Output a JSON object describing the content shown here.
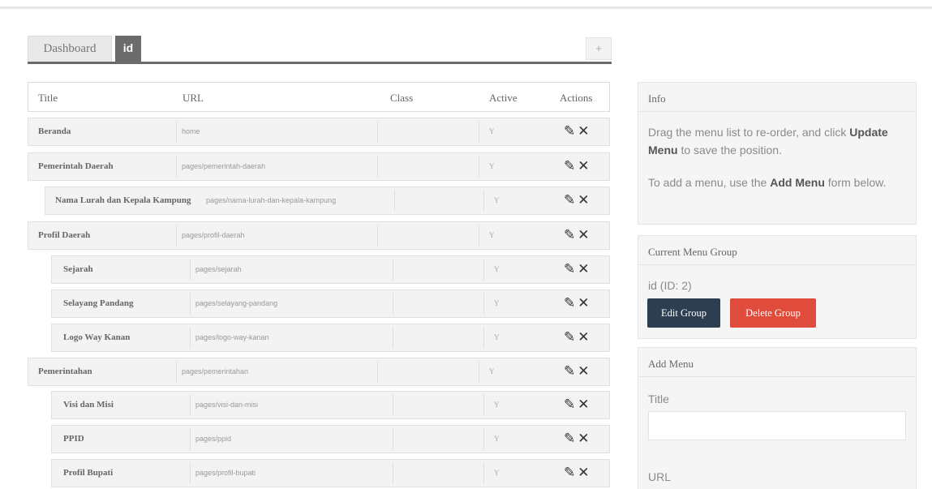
{
  "tabs": {
    "dashboard": "Dashboard",
    "active": "id",
    "add": "+"
  },
  "table": {
    "headers": {
      "title": "Title",
      "url": "URL",
      "class": "Class",
      "active": "Active",
      "actions": "Actions"
    },
    "rows": [
      {
        "title": "Beranda",
        "url": "home",
        "active": "Y"
      },
      {
        "title": "Pemerintah Daerah",
        "url": "pages/pemerintah-daerah",
        "active": "Y"
      },
      {
        "title": "Nama Lurah dan Kepala Kampung",
        "url": "pages/nama-lurah-dan-kepala-kampung",
        "active": "Y"
      },
      {
        "title": "Profil Daerah",
        "url": "pages/profil-daerah",
        "active": "Y"
      },
      {
        "title": "Sejarah",
        "url": "pages/sejarah",
        "active": "Y"
      },
      {
        "title": "Selayang Pandang",
        "url": "pages/selayang-pandang",
        "active": "Y"
      },
      {
        "title": "Logo Way Kanan",
        "url": "pages/logo-way-kanan",
        "active": "Y"
      },
      {
        "title": "Pemerintahan",
        "url": "pages/pemerintahan",
        "active": "Y"
      },
      {
        "title": "Visi dan Misi",
        "url": "pages/visi-dan-misi",
        "active": "Y"
      },
      {
        "title": "PPID",
        "url": "pages/ppid",
        "active": "Y"
      },
      {
        "title": "Profil Bupati",
        "url": "pages/profil-bupati",
        "active": "Y"
      }
    ],
    "edit_icon": "edit-icon",
    "delete_icon": "delete-icon"
  },
  "info": {
    "heading": "Info",
    "line1_pre": "Drag the menu list to re-order, and click",
    "line1_bold": "Update Menu",
    "line1_post": " to save the position.",
    "line2_pre": "To add a menu, use the ",
    "line2_bold": "Add Menu",
    "line2_post": " form below."
  },
  "menu_group": {
    "heading": "Current Menu Group",
    "name": "id (ID: 2)",
    "edit_label": "Edit Group",
    "delete_label": "Delete Group"
  },
  "add_menu": {
    "heading": "Add Menu",
    "title_label": "Title",
    "title_value": "",
    "url_label": "URL"
  },
  "colors": {
    "edit_button": "#2c3e50",
    "delete_button": "#e04c3c",
    "tab_active": "#6b6b6b"
  }
}
